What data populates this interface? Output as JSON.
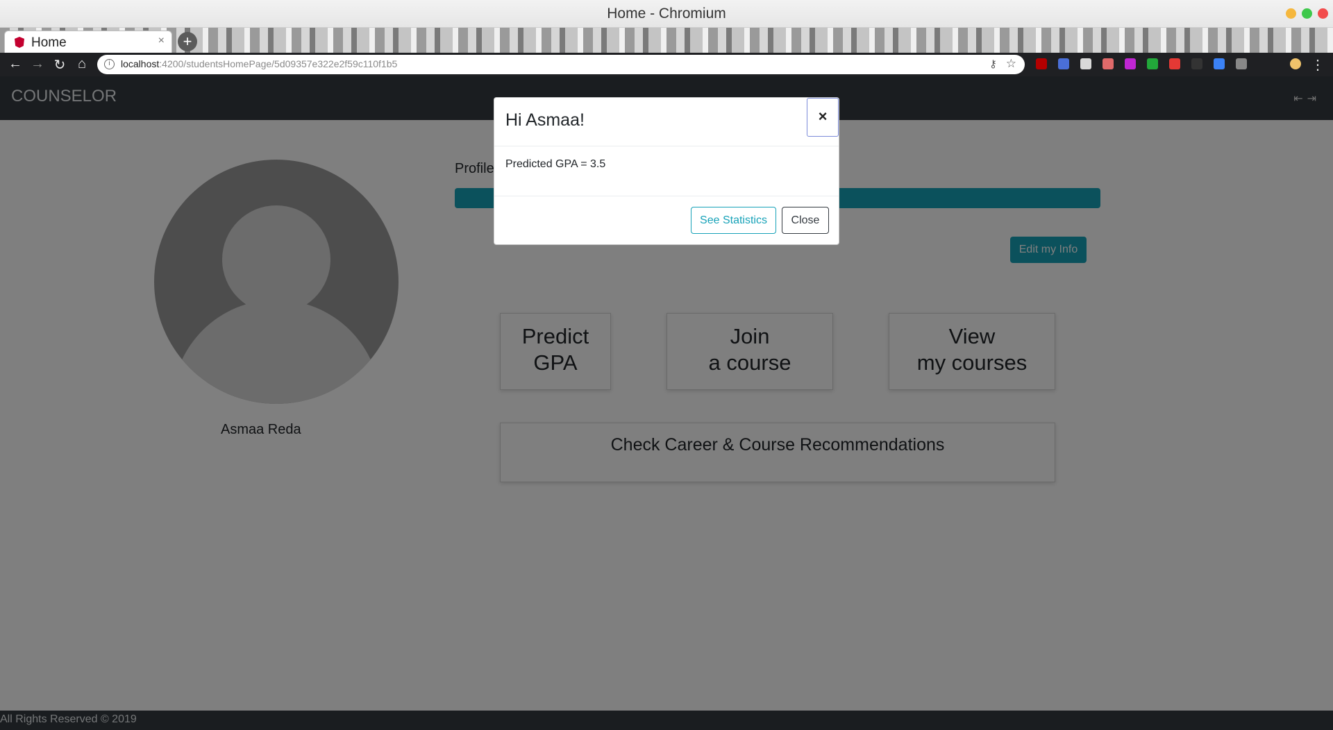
{
  "browser": {
    "window_title": "Home - Chromium",
    "tab_label": "Home",
    "new_tab_symbol": "+",
    "close_tab_symbol": "×",
    "url_host": "localhost",
    "url_path": ":4200/studentsHomePage/5d09357e322e2f59c110f1b5",
    "extension_colors": [
      "#b30000",
      "#4a6fd8",
      "#d9d9d9",
      "#e06a6a",
      "#c026d3",
      "#22a83a",
      "#e53935",
      "#333333",
      "#3b82f6",
      "#888888"
    ]
  },
  "app": {
    "brand": "COUNSELOR",
    "profile_label": "Profile",
    "edit_button": "Edit my Info",
    "user_name": "Asmaa Reda",
    "cards": {
      "predict": [
        "Predict",
        "GPA"
      ],
      "join": [
        "Join",
        "a course"
      ],
      "view": [
        "View",
        "my courses"
      ],
      "career": "Check Career & Course Recommendations"
    },
    "footer": "All Rights Reserved © 2019",
    "accent_color": "#17a2b8",
    "navbar_color": "#343a40"
  },
  "modal": {
    "title": "Hi Asmaa!",
    "close_symbol": "×",
    "body": "Predicted GPA = 3.5",
    "see_statistics": "See Statistics",
    "close": "Close"
  }
}
